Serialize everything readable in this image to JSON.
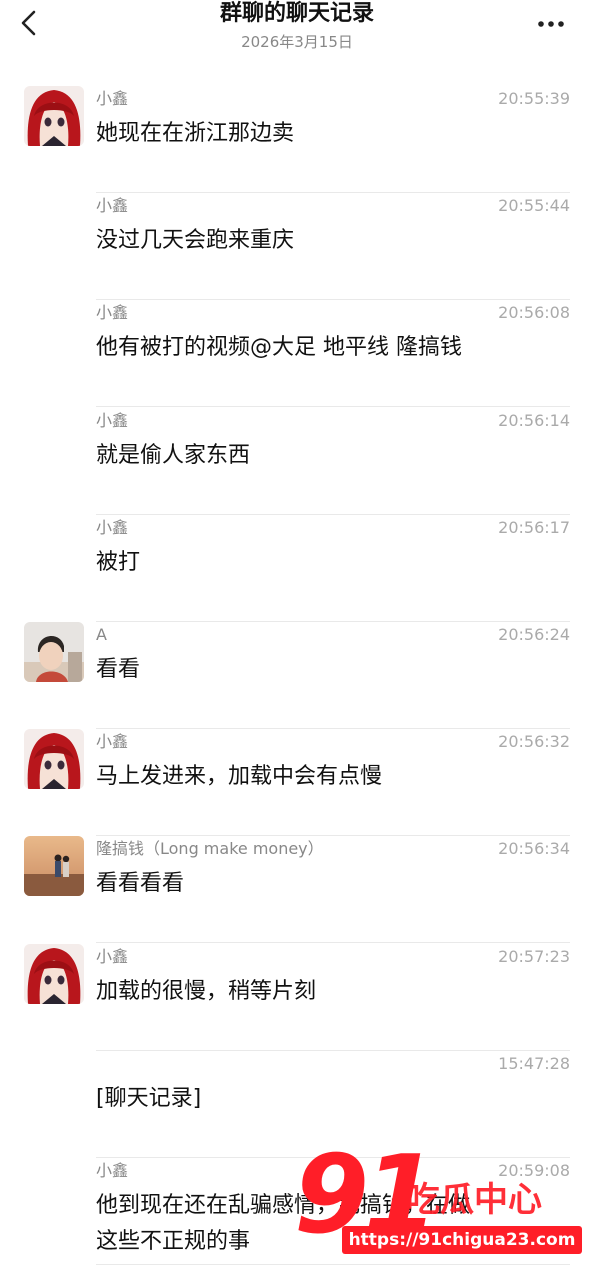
{
  "header": {
    "title": "群聊的聊天记录",
    "date": "2026年3月15日",
    "back_icon": "chevron-left-icon",
    "more_icon": "more-horizontal-icon"
  },
  "messages": [
    {
      "sender": "小鑫",
      "time": "20:55:39",
      "text": "她现在在浙江那边卖",
      "avatar": "anime-girl-red-hair"
    },
    {
      "sender": "小鑫",
      "time": "20:55:44",
      "text": "没过几天会跑来重庆",
      "avatar": ""
    },
    {
      "sender": "小鑫",
      "time": "20:56:08",
      "text": "他有被打的视频@大足  地平线 隆搞钱",
      "avatar": ""
    },
    {
      "sender": "小鑫",
      "time": "20:56:14",
      "text": "就是偷人家东西",
      "avatar": ""
    },
    {
      "sender": "小鑫",
      "time": "20:56:17",
      "text": "被打",
      "avatar": ""
    },
    {
      "sender": "A",
      "time": "20:56:24",
      "text": "看看",
      "avatar": "boy-photo"
    },
    {
      "sender": "小鑫",
      "time": "20:56:32",
      "text": "马上发进来，加载中会有点慢",
      "avatar": "anime-girl-red-hair"
    },
    {
      "sender": "隆搞钱（Long make money）",
      "time": "20:56:34",
      "text": "看看看看",
      "avatar": "couple-sunset-photo"
    },
    {
      "sender": "小鑫",
      "time": "20:57:23",
      "text": "加载的很慢，稍等片刻",
      "avatar": "anime-girl-red-hair"
    },
    {
      "sender": "",
      "time": "15:47:28",
      "text": "[聊天记录]",
      "avatar": ""
    },
    {
      "sender": "小鑫",
      "time": "20:59:08",
      "text": "他到现在还在乱骗感情，乱搞钱，在做\n这些不正规的事",
      "avatar": ""
    }
  ],
  "watermark": {
    "number": "91",
    "brand": "吃瓜中心",
    "url": "https://91chigua23.com"
  },
  "colors": {
    "accent": "#ff1e28",
    "meta_text": "#888888",
    "divider": "#e9e9e9"
  }
}
